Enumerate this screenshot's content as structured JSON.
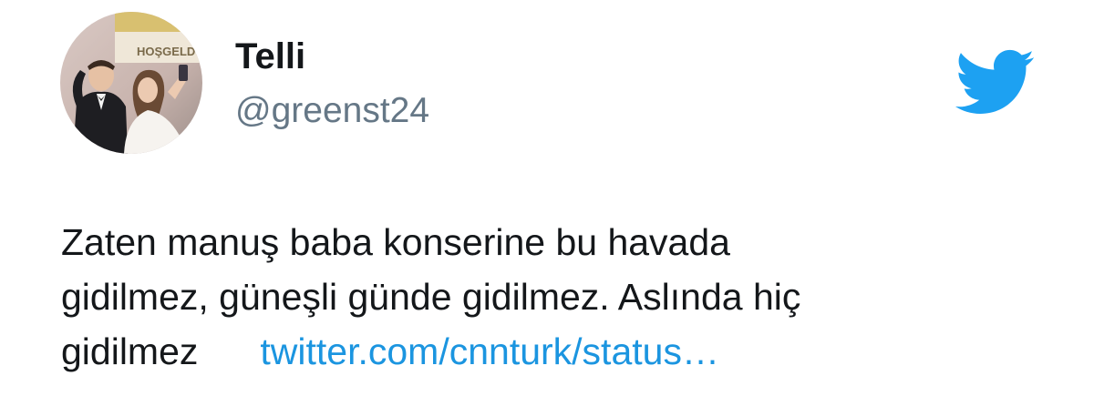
{
  "tweet": {
    "author": {
      "display_name": "Telli",
      "handle": "@greenst24",
      "avatar_sign_text": "HOŞGELD"
    },
    "brand_icon": "twitter-bird-icon",
    "text_lines": [
      "Zaten manuş baba konserine bu havada",
      "gidilmez, güneşli günde gidilmez. Aslında hiç",
      "gidilmez"
    ],
    "link_text": "twitter.com/cnnturk/status…"
  },
  "colors": {
    "text": "#14171a",
    "secondary_text": "#657786",
    "link": "#1b95e0",
    "brand": "#1da1f2"
  }
}
